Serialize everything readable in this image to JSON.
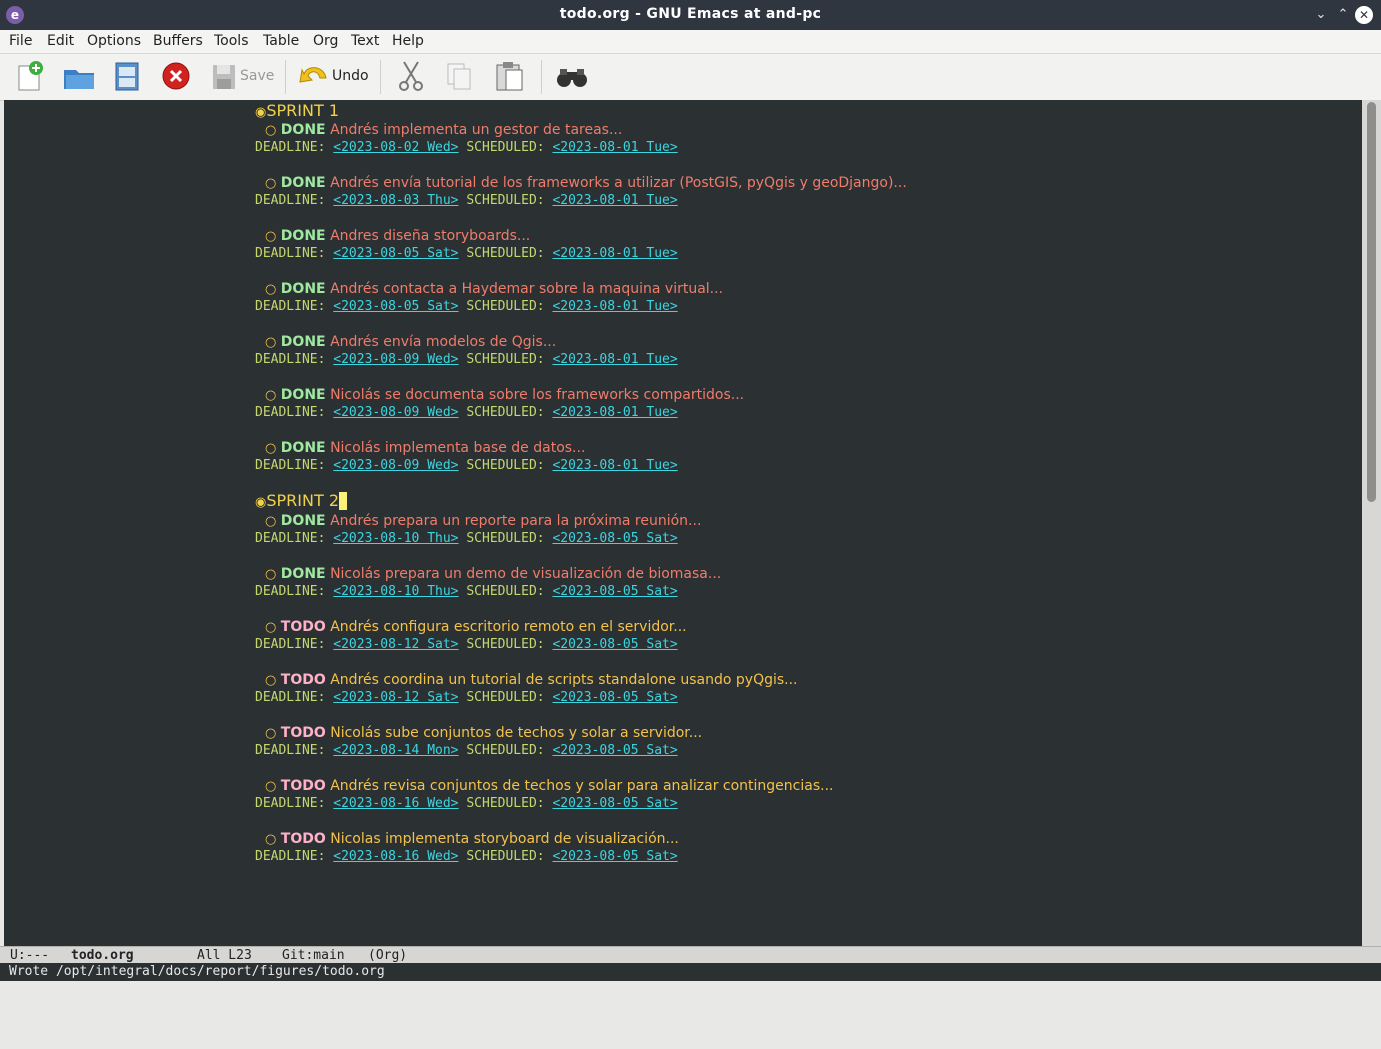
{
  "window": {
    "title": "todo.org - GNU Emacs at and-pc"
  },
  "menubar": {
    "items": [
      "File",
      "Edit",
      "Options",
      "Buffers",
      "Tools",
      "Table",
      "Org",
      "Text",
      "Help"
    ]
  },
  "toolbar": {
    "save_label": "Save",
    "undo_label": "Undo"
  },
  "colors": {
    "background": "#2b3033",
    "heading": "#f0d24c",
    "done_keyword": "#9fe89f",
    "todo_keyword": "#ffb1c8",
    "date_link": "#3cd5e0",
    "meta": "#c6d76e"
  },
  "buffer": {
    "sprints": [
      {
        "title": "SPRINT 1",
        "tasks": [
          {
            "state": "DONE",
            "text": "Andrés implementa un gestor de tareas...",
            "deadline": "<2023-08-02 Wed>",
            "scheduled": "<2023-08-01 Tue>"
          },
          {
            "state": "DONE",
            "text": "Andrés envía tutorial de los frameworks a utilizar (PostGIS, pyQgis y geoDjango)...",
            "deadline": "<2023-08-03 Thu>",
            "scheduled": "<2023-08-01 Tue>"
          },
          {
            "state": "DONE",
            "text": "Andres diseña storyboards...",
            "deadline": "<2023-08-05 Sat>",
            "scheduled": "<2023-08-01 Tue>"
          },
          {
            "state": "DONE",
            "text": "Andrés contacta a Haydemar sobre la maquina virtual...",
            "deadline": "<2023-08-05 Sat>",
            "scheduled": "<2023-08-01 Tue>"
          },
          {
            "state": "DONE",
            "text": "Andrés envía modelos de Qgis...",
            "deadline": "<2023-08-09 Wed>",
            "scheduled": "<2023-08-01 Tue>"
          },
          {
            "state": "DONE",
            "text": "Nicolás se documenta sobre los frameworks compartidos...",
            "deadline": "<2023-08-09 Wed>",
            "scheduled": "<2023-08-01 Tue>"
          },
          {
            "state": "DONE",
            "text": "Nicolás implementa base de datos...",
            "deadline": "<2023-08-09 Wed>",
            "scheduled": "<2023-08-01 Tue>"
          }
        ]
      },
      {
        "title": "SPRINT 2",
        "tasks": [
          {
            "state": "DONE",
            "text": "Andrés prepara un reporte para la próxima reunión...",
            "deadline": "<2023-08-10 Thu>",
            "scheduled": "<2023-08-05 Sat>"
          },
          {
            "state": "DONE",
            "text": "Nicolás prepara un demo de visualización de biomasa...",
            "deadline": "<2023-08-10 Thu>",
            "scheduled": "<2023-08-05 Sat>"
          },
          {
            "state": "TODO",
            "text": "Andrés configura escritorio remoto en el servidor...",
            "deadline": "<2023-08-12 Sat>",
            "scheduled": "<2023-08-05 Sat>"
          },
          {
            "state": "TODO",
            "text": "Andrés coordina un tutorial de scripts standalone usando pyQgis...",
            "deadline": "<2023-08-12 Sat>",
            "scheduled": "<2023-08-05 Sat>"
          },
          {
            "state": "TODO",
            "text": "Nicolás sube conjuntos de techos y solar a servidor...",
            "deadline": "<2023-08-14 Mon>",
            "scheduled": "<2023-08-05 Sat>"
          },
          {
            "state": "TODO",
            "text": "Andrés revisa conjuntos de techos y solar para analizar contingencias...",
            "deadline": "<2023-08-16 Wed>",
            "scheduled": "<2023-08-05 Sat>"
          },
          {
            "state": "TODO",
            "text": "Nicolas implementa storyboard de visualización...",
            "deadline": "<2023-08-16 Wed>",
            "scheduled": "<2023-08-05 Sat>"
          }
        ]
      }
    ],
    "deadline_label": "DEADLINE:",
    "scheduled_label": "SCHEDULED:"
  },
  "modeline": {
    "status": "U:---",
    "buffer_name": "todo.org",
    "position": "All L23",
    "vc": "Git:main",
    "mode": "(Org)"
  },
  "echo_area": {
    "message": "Wrote /opt/integral/docs/report/figures/todo.org"
  }
}
